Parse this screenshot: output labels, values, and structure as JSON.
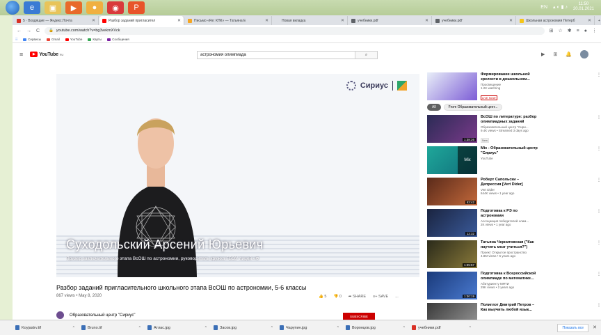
{
  "os": {
    "tray": {
      "lang": "EN",
      "time": "11:50",
      "date": "20.01.2021"
    }
  },
  "browser": {
    "tabs": [
      {
        "label": "5 · Входящие — Яндекс.Почта",
        "color": "#d93025"
      },
      {
        "label": "Разбор заданий пригласител",
        "color": "#ff0000",
        "active": true
      },
      {
        "label": "Письмо «Re: КПК» — Татьяна Е",
        "color": "#f5a623"
      },
      {
        "label": "Новая вкладка",
        "color": "#dee1e6"
      },
      {
        "label": "учебники.pdf",
        "color": "#5f6368"
      },
      {
        "label": "учебники.pdf",
        "color": "#5f6368"
      },
      {
        "label": "Школьная астрономия Петерб",
        "color": "#f5c518"
      }
    ],
    "url": "youtube.com/watch?v=bg3vekmXVck",
    "bookmarks": [
      {
        "label": "Сервисы",
        "color": "#4285f4"
      },
      {
        "label": "Gmail",
        "color": "#ea4335"
      },
      {
        "label": "YouTube",
        "color": "#ff0000"
      },
      {
        "label": "Карты",
        "color": "#34a853"
      },
      {
        "label": "Сообщения",
        "color": "#7b1fa2"
      }
    ]
  },
  "youtube": {
    "logo": "YouTube",
    "logo_region": "RU",
    "search_query": "астрономия олимпиада",
    "video": {
      "overlay_brand": "Сириус",
      "caption_name": "Суходольский Арсений Юрьевич",
      "caption_role": "Призер заключительного этапа ВсОШ по астрономии, руководитель кружка ГБОУ лицей «Ф",
      "title": "Разбор заданий пригласительного школьного этапа ВсОШ по астрономии, 5-6 классы",
      "meta": "867 views • May 8, 2020",
      "likes": "5",
      "dislikes": "0",
      "share": "SHARE",
      "save": "SAVE",
      "more": "...",
      "channel": "Образовательный центр \"Сириус\"",
      "subscribe": "SUBSCRIBE"
    },
    "chips": [
      "All",
      "From Образовательный цент..."
    ],
    "recommendations": [
      {
        "title": "Формирование школьной зрелости в дошкольном...",
        "channel": "Просвещение",
        "meta": "1.2K watching",
        "badge": "LIVE NOW",
        "badge_type": "live",
        "duration": "",
        "thumb": [
          "#e8eef8",
          "#7c5cd6"
        ]
      },
      {
        "title": "ВсОШ по литературе: разбор олимпиадных заданий",
        "channel": "Образовательный центр \"Сири...",
        "meta": "9.4K views • Streamed 3 days ago",
        "badge": "New",
        "badge_type": "new",
        "duration": "1:38:26",
        "thumb": [
          "#2b2b55",
          "#7a3a8a"
        ]
      },
      {
        "title": "Mix - Образовательный центр \"Сириус\"",
        "channel": "YouTube",
        "meta": "",
        "badge": "",
        "badge_type": "",
        "duration": "",
        "thumb": [
          "#1fa79a",
          "#0f6e7a"
        ],
        "mix": "Mix"
      },
      {
        "title": "Роберт Сапольски – Депрессия [Vert Dider]",
        "channel": "Vert Dider",
        "meta": "644K views • 1 year ago",
        "badge": "",
        "badge_type": "",
        "duration": "52:42",
        "thumb": [
          "#5a2a1a",
          "#c2683a"
        ]
      },
      {
        "title": "Подготовка к РЭ по астрономии",
        "channel": "Ассоциация победителей олим...",
        "meta": "2K views • 1 year ago",
        "badge": "",
        "badge_type": "",
        "duration": "12:32",
        "thumb": [
          "#1a2440",
          "#3a5a9a"
        ]
      },
      {
        "title": "Татьяна Черниговская (\"Как научить мозг учиться?\")",
        "channel": "Проект Открытое пространство",
        "meta": "4.8M views • 5 years ago",
        "badge": "",
        "badge_type": "",
        "duration": "1:35:57",
        "thumb": [
          "#2a2a1a",
          "#8a7a3a"
        ]
      },
      {
        "title": "Подготовка к Всероссийской олимпиаде по математике...",
        "channel": "Абитуриенту МФТИ",
        "meta": "29K views • 2 years ago",
        "badge": "",
        "badge_type": "",
        "duration": "1:30:19",
        "thumb": [
          "#1a3a7a",
          "#4a7ad0"
        ]
      },
      {
        "title": "Полиглот Дмитрий Петров – Как выучить любой язык...",
        "channel": "",
        "meta": "",
        "badge": "",
        "badge_type": "",
        "duration": "",
        "thumb": [
          "#3a3a3a",
          "#9a9a9a"
        ]
      }
    ]
  },
  "downloads": {
    "items": [
      {
        "name": "Koyjastrv.tif",
        "type": "img"
      },
      {
        "name": "Bruno.tif",
        "type": "img"
      },
      {
        "name": "Атлас.jpg",
        "type": "img"
      },
      {
        "name": "Засов.jpg",
        "type": "img"
      },
      {
        "name": "Чарупин.jpg",
        "type": "img"
      },
      {
        "name": "Воронцов.jpg",
        "type": "img"
      },
      {
        "name": "учебники.pdf",
        "type": "pdf"
      }
    ],
    "show_all": "Показать все"
  }
}
